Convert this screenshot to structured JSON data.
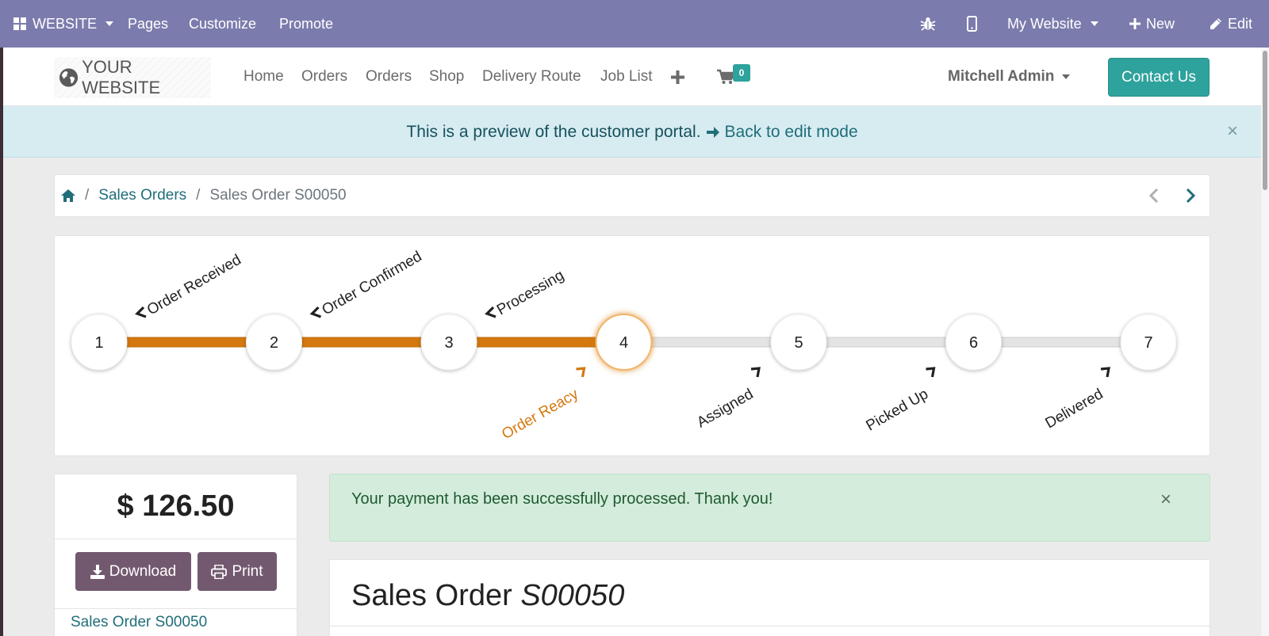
{
  "topbar": {
    "website_label": "WEBSITE",
    "pages_label": "Pages",
    "customize_label": "Customize",
    "promote_label": "Promote",
    "my_website_label": "My Website",
    "new_label": "New",
    "edit_label": "Edit",
    "bg_color": "#7c7bad"
  },
  "header": {
    "logo_text": "YOUR WEBSITE",
    "nav": {
      "home": "Home",
      "orders_1": "Orders",
      "orders_2": "Orders",
      "shop": "Shop",
      "delivery_route": "Delivery Route",
      "job_list": "Job List"
    },
    "cart_count": "0",
    "user_name": "Mitchell Admin",
    "contact_label": "Contact Us",
    "accent_color": "#2ea29c"
  },
  "preview_banner": {
    "message": "This is a preview of the customer portal.",
    "back_link": "Back to edit mode"
  },
  "breadcrumb": {
    "level1": "Sales Orders",
    "current": "Sales Order S00050"
  },
  "tracker": {
    "current_step": 4,
    "active_color": "#d4780f",
    "steps": [
      {
        "number": "1",
        "label": "Order Received"
      },
      {
        "number": "2",
        "label": "Order Confirmed"
      },
      {
        "number": "3",
        "label": "Processing"
      },
      {
        "number": "4",
        "label": "Order Reacy"
      },
      {
        "number": "5",
        "label": "Assigned"
      },
      {
        "number": "6",
        "label": "Picked Up"
      },
      {
        "number": "7",
        "label": "Delivered"
      }
    ]
  },
  "sidebar": {
    "amount": "$ 126.50",
    "download_label": "Download",
    "print_label": "Print",
    "order_link": "Sales Order S00050"
  },
  "alert": {
    "message": "Your payment has been successfully processed. Thank you!"
  },
  "order": {
    "title_prefix": "Sales Order",
    "number": "S00050"
  }
}
